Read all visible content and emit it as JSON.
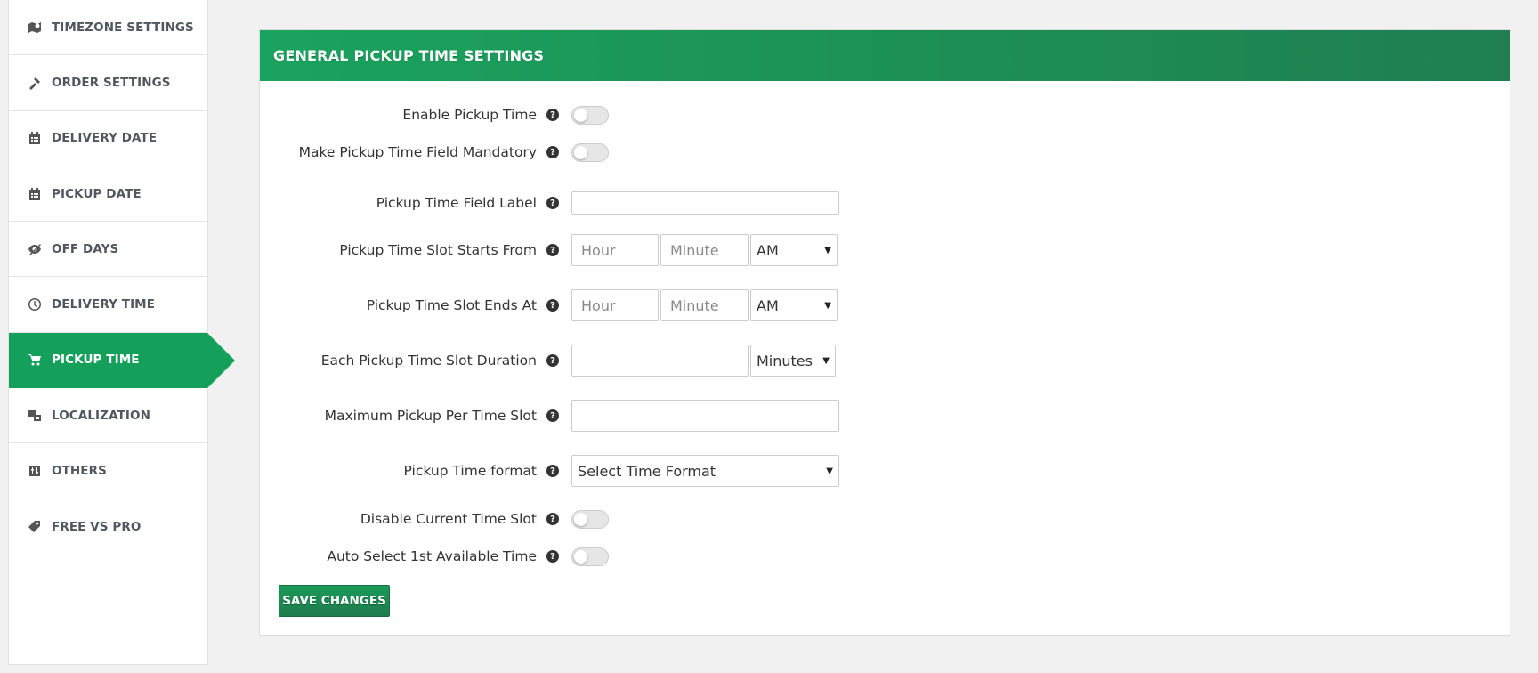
{
  "sidebar": {
    "items": [
      {
        "label": "TIMEZONE SETTINGS",
        "icon": "map-pin-icon"
      },
      {
        "label": "ORDER SETTINGS",
        "icon": "tools-icon"
      },
      {
        "label": "DELIVERY DATE",
        "icon": "calendar-icon"
      },
      {
        "label": "PICKUP DATE",
        "icon": "calendar-icon"
      },
      {
        "label": "OFF DAYS",
        "icon": "eye-slash-icon"
      },
      {
        "label": "DELIVERY TIME",
        "icon": "clock-icon"
      },
      {
        "label": "PICKUP TIME",
        "icon": "cart-icon",
        "active": true
      },
      {
        "label": "LOCALIZATION",
        "icon": "language-icon"
      },
      {
        "label": "OTHERS",
        "icon": "sliders-icon"
      },
      {
        "label": "FREE VS PRO",
        "icon": "tags-icon"
      }
    ]
  },
  "panel": {
    "title": "GENERAL PICKUP TIME SETTINGS",
    "fields": {
      "enable_pickup_time": {
        "label": "Enable Pickup Time",
        "enabled": false
      },
      "mandatory": {
        "label": "Make Pickup Time Field Mandatory",
        "enabled": false
      },
      "field_label": {
        "label": "Pickup Time Field Label",
        "value": ""
      },
      "slot_starts": {
        "label": "Pickup Time Slot Starts From",
        "hour_placeholder": "Hour",
        "minute_placeholder": "Minute",
        "ampm": "AM"
      },
      "slot_ends": {
        "label": "Pickup Time Slot Ends At",
        "hour_placeholder": "Hour",
        "minute_placeholder": "Minute",
        "ampm": "AM"
      },
      "slot_duration": {
        "label": "Each Pickup Time Slot Duration",
        "value": "",
        "unit": "Minutes"
      },
      "max_pickup": {
        "label": "Maximum Pickup Per Time Slot",
        "value": ""
      },
      "time_format": {
        "label": "Pickup Time format",
        "selected": "Select Time Format"
      },
      "disable_current": {
        "label": "Disable Current Time Slot",
        "enabled": false
      },
      "auto_select": {
        "label": "Auto Select 1st Available Time",
        "enabled": false
      }
    },
    "help_glyph": "?",
    "save_label": "SAVE CHANGES"
  },
  "colors": {
    "accent": "#14a05b",
    "header_start": "#1aa35e",
    "header_end": "#1f7f4f"
  }
}
